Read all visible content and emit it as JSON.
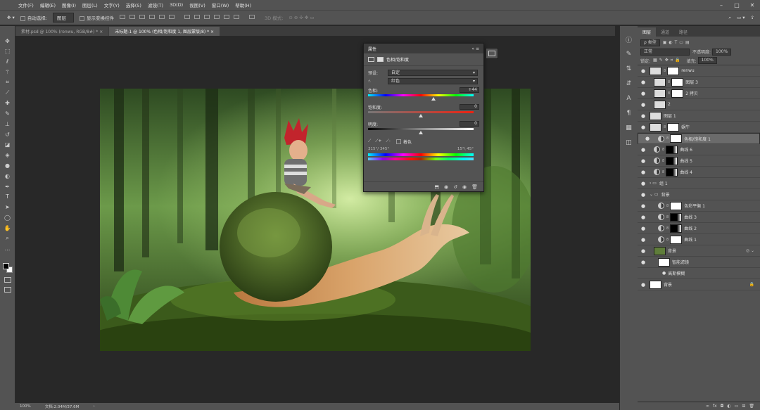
{
  "menu": [
    "文件(F)",
    "编辑(E)",
    "图像(I)",
    "图层(L)",
    "文字(Y)",
    "选择(S)",
    "滤镜(T)",
    "3D(D)",
    "视图(V)",
    "窗口(W)",
    "帮助(H)"
  ],
  "options": {
    "auto_select": "自动选择:",
    "auto_select_value": "图层",
    "show_transform": "显示变换控件",
    "mode_3d": "3D 模式:"
  },
  "tabs": [
    "素材.psd @ 100% (renwu, RGB/8#) *",
    "未标题-1 @ 100% (色相/饱和度 1, 图层蒙版/8) *"
  ],
  "status": {
    "zoom": "100%",
    "doc": "文档:2.04M/37.6M"
  },
  "properties": {
    "header": "属性",
    "title": "色相/饱和度",
    "preset_label": "预设:",
    "preset_value": "自定",
    "channel_value": "红色",
    "hue_label": "色相:",
    "hue_value": 44,
    "saturation_label": "饱和度:",
    "saturation_value": 0,
    "lightness_label": "明度:",
    "lightness_value": 0,
    "colorize": "着色",
    "range_left": "315°/ 345°",
    "range_right": "15°\\ 45°"
  },
  "layers_panel": {
    "tabs": [
      "图层",
      "通道",
      "路径"
    ],
    "filter_kind": "ρ 类型",
    "blend_mode": "正常",
    "opacity_label": "不透明度:",
    "opacity_value": "100%",
    "lock_label": "锁定:",
    "fill_label": "填充:",
    "fill_value": "100%",
    "layers": [
      {
        "name": "renwu",
        "kind": "pixel",
        "indent": 0,
        "mask": true
      },
      {
        "name": "图层 3",
        "kind": "pixel",
        "indent": 1,
        "mask": true
      },
      {
        "name": "2 拷贝",
        "kind": "pixel",
        "indent": 1,
        "mask": true
      },
      {
        "name": "2",
        "kind": "pixel",
        "indent": 1,
        "mask": false
      },
      {
        "name": "图层 1",
        "kind": "pixel",
        "indent": 0,
        "mask": false
      },
      {
        "name": "蜗牛",
        "kind": "pixel",
        "indent": 0,
        "mask": true
      },
      {
        "name": "色相/饱和度 1",
        "kind": "adj",
        "indent": 1,
        "mask": true,
        "selected": true
      },
      {
        "name": "曲线 6",
        "kind": "adj",
        "indent": 1,
        "mask": true,
        "dark": true
      },
      {
        "name": "曲线 5",
        "kind": "adj",
        "indent": 1,
        "mask": true,
        "dark": true
      },
      {
        "name": "曲线 4",
        "kind": "adj",
        "indent": 1,
        "mask": true,
        "dark": true
      },
      {
        "name": "组 1",
        "kind": "group",
        "indent": 0
      },
      {
        "name": "背景",
        "kind": "group",
        "indent": 0,
        "open": true
      },
      {
        "name": "色彩平衡 1",
        "kind": "adj",
        "indent": 2,
        "mask": true
      },
      {
        "name": "曲线 3",
        "kind": "adj",
        "indent": 2,
        "mask": true,
        "dark": true
      },
      {
        "name": "曲线 2",
        "kind": "adj",
        "indent": 2,
        "mask": true,
        "dark": true
      },
      {
        "name": "曲线 1",
        "kind": "adj",
        "indent": 2,
        "mask": true
      },
      {
        "name": "背景",
        "kind": "smart",
        "indent": 1
      },
      {
        "name": "智能滤镜",
        "kind": "filter",
        "indent": 2
      },
      {
        "name": "高斯模糊",
        "kind": "filteritem",
        "indent": 3
      },
      {
        "name": "背景",
        "kind": "bg",
        "indent": 0
      }
    ]
  }
}
